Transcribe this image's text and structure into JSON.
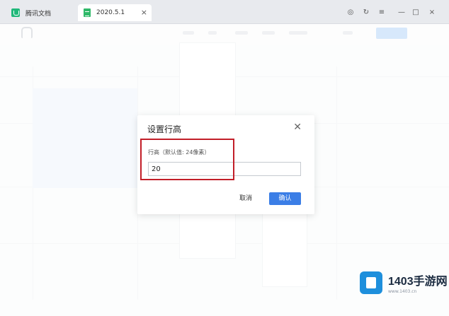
{
  "window": {
    "app_tab_label": "腾讯文档",
    "doc_tab_label": "2020.5.1",
    "tab_close": "×",
    "controls": [
      "◎",
      "↻",
      "≡",
      "—",
      "□",
      "×"
    ]
  },
  "dialog": {
    "title": "设置行高",
    "close_glyph": "✕",
    "field_label": "行高（默认值: 24像素）",
    "field_value": "20",
    "cancel_label": "取消",
    "ok_label": "确认"
  },
  "colors": {
    "accent": "#3b7ee6",
    "highlight_border": "#c21e28"
  },
  "watermark": {
    "title": "1403手游网",
    "subtitle": "www.1403.cn"
  }
}
